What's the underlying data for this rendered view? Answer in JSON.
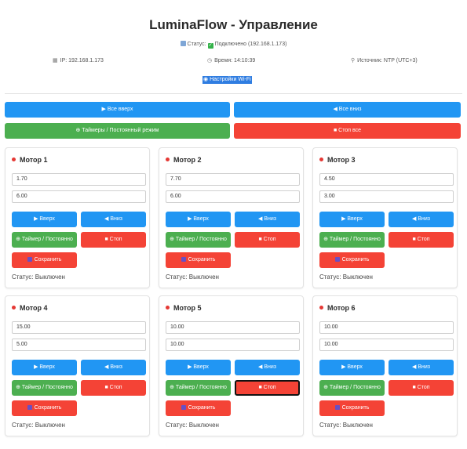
{
  "header": {
    "title": "LuminaFlow - Управление",
    "status_label": "Статус:",
    "status_value": "Подключено (192.168.1.173)",
    "ip_text": "IP: 192.168.1.173",
    "time_text": "Время: 14:10:39",
    "source_text": "Источник: NTP (UTC+3)",
    "wifi_link": "Настройки Wi-Fi"
  },
  "global": {
    "all_up": "▶ Все вверх",
    "all_down": "◀ Все вниз",
    "timers": "⊕ Таймеры / Постоянный режим",
    "stop_all": "■ Стоп все"
  },
  "buttons": {
    "up": "▶ Вверх",
    "down": "◀ Вниз",
    "timer": "⊕ Таймер / Постоянно",
    "stop": "■ Стоп",
    "save": "Сохранить"
  },
  "motors": [
    {
      "name": "Мотор 1",
      "field1": "1.70",
      "field2": "6.00",
      "status": "Статус: Выключен"
    },
    {
      "name": "Мотор 2",
      "field1": "7.70",
      "field2": "6.00",
      "status": "Статус: Выключен"
    },
    {
      "name": "Мотор 3",
      "field1": "4.50",
      "field2": "3.00",
      "status": "Статус: Выключен"
    },
    {
      "name": "Мотор 4",
      "field1": "15.00",
      "field2": "5.00",
      "status": "Статус: Выключен"
    },
    {
      "name": "Мотор 5",
      "field1": "10.00",
      "field2": "10.00",
      "status": "Статус: Выключен"
    },
    {
      "name": "Мотор 6",
      "field1": "10.00",
      "field2": "10.00",
      "status": "Статус: Выключен"
    }
  ],
  "colors": {
    "blue": "#2196f3",
    "green": "#4caf50",
    "red": "#f44336",
    "status_dot": "#e53935"
  }
}
